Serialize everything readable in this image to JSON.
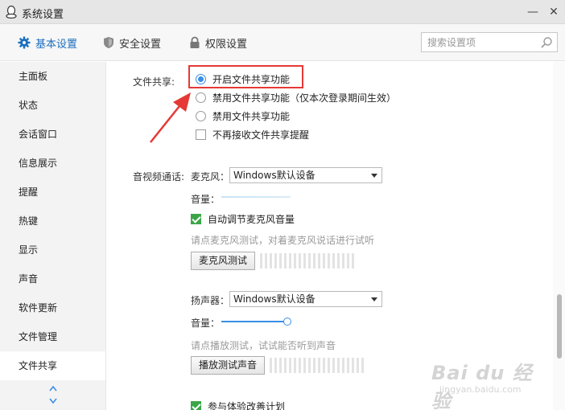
{
  "window": {
    "title": "系统设置",
    "minimize": "—",
    "close": "✕"
  },
  "tabs": [
    {
      "label": "基本设置",
      "icon": "gear-icon",
      "active": true
    },
    {
      "label": "安全设置",
      "icon": "shield-icon",
      "active": false
    },
    {
      "label": "权限设置",
      "icon": "lock-icon",
      "active": false
    }
  ],
  "search": {
    "placeholder": "搜索设置项",
    "value": ""
  },
  "sidebar": {
    "items": [
      {
        "label": "主面板"
      },
      {
        "label": "状态"
      },
      {
        "label": "会话窗口"
      },
      {
        "label": "信息展示"
      },
      {
        "label": "提醒"
      },
      {
        "label": "热键"
      },
      {
        "label": "显示"
      },
      {
        "label": "声音"
      },
      {
        "label": "软件更新"
      },
      {
        "label": "文件管理"
      },
      {
        "label": "文件共享",
        "active": true
      }
    ]
  },
  "file_share": {
    "label": "文件共享:",
    "options": [
      {
        "label": "开启文件共享功能",
        "selected": true
      },
      {
        "label": "禁用文件共享功能（仅本次登录期间生效）",
        "selected": false
      },
      {
        "label": "禁用文件共享功能",
        "selected": false
      }
    ],
    "no_reminder": {
      "label": "不再接收文件共享提醒",
      "checked": false
    }
  },
  "av_call": {
    "label": "音视频通话:",
    "mic": {
      "label": "麦克风：",
      "device": "Windows默认设备",
      "volume_label": "音量：",
      "auto_adjust": {
        "label": "自动调节麦克风音量",
        "checked": true
      },
      "hint": "请点麦克风测试，对着麦克风说话进行试听",
      "test_button": "麦克风测试"
    },
    "speaker": {
      "label": "扬声器：",
      "device": "Windows默认设备",
      "volume_label": "音量：",
      "volume": 1.0,
      "hint": "请点播放测试，试试能否听到声音",
      "test_button": "播放测试声音"
    },
    "experience_plan": {
      "label": "参与体验改善计划",
      "checked": true
    }
  },
  "watermark": {
    "main": "Bai du 经验",
    "sub": "jingyan.baidu.com"
  },
  "colors": {
    "accent": "#1c6fbf",
    "highlight": "#e53935",
    "check": "#3aa648"
  }
}
